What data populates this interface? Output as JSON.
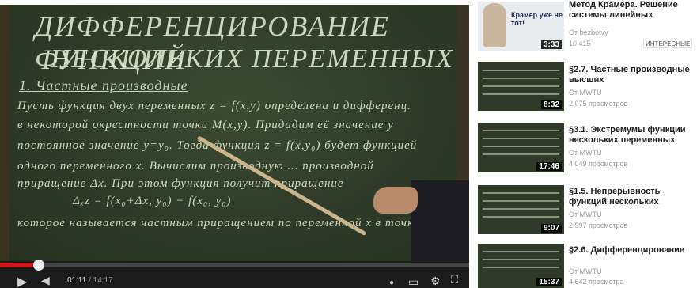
{
  "video": {
    "board_title_line1": "ДИФФЕРЕНЦИРОВАНИЕ ФУНКЦИЙ",
    "board_title_line2": "НЕСКОЛЬКИХ ПЕРЕМЕННЫХ",
    "board_subtitle": "1. Частные производные",
    "board_lines": [
      "Пусть функция двух переменных z = f(x,y) определена и дифференц.",
      "в некоторой окрестности точки M(x,y). Придадим её значение y",
      "постоянное значение y=y₀. Тогда функция z = f(x,y₀) будет функцией",
      "одного переменного x. Вычислим производную ... производной",
      "приращение Δx. При этом функция получит приращение",
      "Δₓz = f(x₀+Δx, y₀) − f(x₀, y₀)",
      "которое называется частным приращением по переменной x в точке"
    ],
    "current_time": "01:11",
    "duration": "14:17",
    "progress": 0.083
  },
  "sidebar": {
    "items": [
      {
        "title": "Метод Крамера. Решение системы линейных",
        "author": "От bezbotvy",
        "views": "10 415",
        "badge": "ИНТЕРЕСНЫЕ",
        "duration": "3:33",
        "thumb_text": "Крамер уже не тот!"
      },
      {
        "title": "§2.7. Частные производные высших",
        "author": "От MWTU",
        "views": "2 075 просмотров",
        "duration": "8:32"
      },
      {
        "title": "§3.1. Экстремумы функции нескольких переменных",
        "author": "От MWTU",
        "views": "4 049 просмотров",
        "duration": "17:46"
      },
      {
        "title": "§1.5. Непрерывность функций нескольких",
        "author": "От MWTU",
        "views": "2 997 просмотров",
        "duration": "9:07"
      },
      {
        "title": "§2.6. Дифференцирование",
        "author": "От MWTU",
        "views": "4 642 просмотра",
        "duration": "15:37"
      }
    ]
  }
}
